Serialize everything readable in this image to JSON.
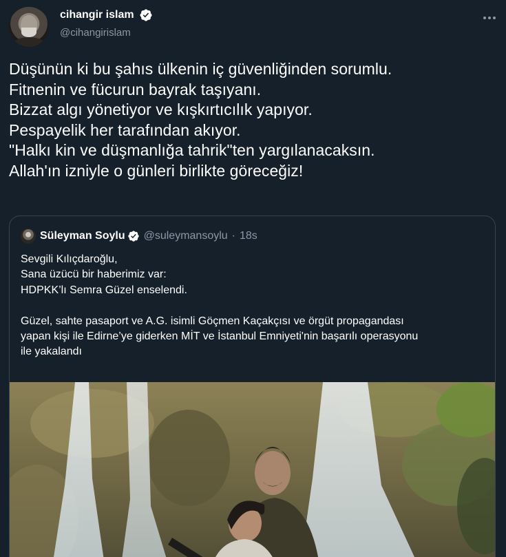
{
  "author": {
    "display_name": "cihangir islam",
    "handle": "@cihangirislam",
    "verified": true
  },
  "tweet": {
    "lines": [
      "Düşünün ki bu şahıs ülkenin iç güvenliğinden sorumlu.",
      "Fitnenin ve fücurun bayrak taşıyanı.",
      "Bizzat algı yönetiyor ve kışkırtıcılık yapıyor.",
      "Pespayelik her tarafından akıyor.",
      "\"Halkı kin ve düşmanlığa tahrik\"ten yargılanacaksın.",
      "Allah'ın izniyle o günleri birlikte göreceğiz!"
    ]
  },
  "quoted_tweet": {
    "display_name": "Süleyman Soylu",
    "handle": "@suleymansoylu",
    "separator": "·",
    "time": "18s",
    "lines": [
      "Sevgili Kılıçdaroğlu,",
      "Sana üzücü bir haberimiz var:",
      "HDPKK’lı Semra Güzel enselendi.",
      "",
      "Güzel, sahte pasaport ve A.G. isimli Göçmen Kaçakçısı ve örgüt propagandası",
      "yapan kişi ile Edirne’ye giderken MİT ve İstanbul Emniyeti'nin başarılı operasyonu",
      "ile yakalandı"
    ]
  },
  "icons": {
    "more": "more-horizontal-icon",
    "verified": "verified-badge-icon"
  },
  "colors": {
    "background": "#15202b",
    "text": "#ffffff",
    "secondary_text": "#8b98a5",
    "border": "#38444d",
    "verified": "#ffffff"
  }
}
